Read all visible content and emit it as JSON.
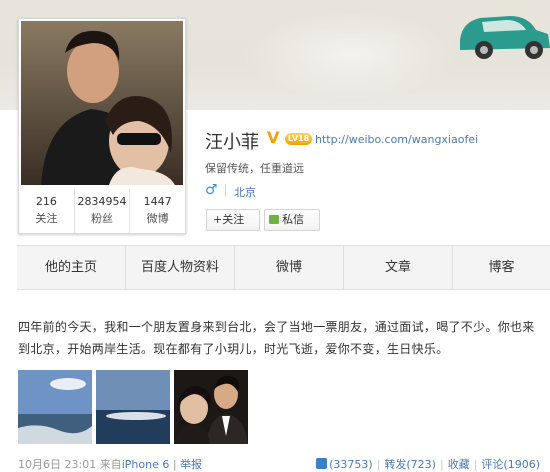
{
  "profile": {
    "name": "汪小菲",
    "level_badge": "LV18",
    "url": "http://weibo.com/wangxiaofei",
    "bio": "保留传统，任重道远",
    "gender_symbol": "♂",
    "location": "北京",
    "follow_label": "+关注",
    "message_label": "私信",
    "verified_symbol": "V"
  },
  "stats": [
    {
      "value": "216",
      "label": "关注"
    },
    {
      "value": "2834954",
      "label": "粉丝"
    },
    {
      "value": "1447",
      "label": "微博"
    }
  ],
  "tabs": [
    "他的主页",
    "百度人物资料",
    "微博",
    "文章",
    "博客"
  ],
  "post": {
    "text": "四年前的今天，我和一个朋友置身来到台北，会了当地一票朋友，通过面试，喝了不少。你也来到北京，开始两岸生活。现在都有了小玥儿，时光飞逝，爱你不变，生日快乐。",
    "time": "10月6日 23:01",
    "source_prefix": "来自",
    "source": "iPhone 6",
    "report": "举报",
    "likes": "(33753)",
    "repost": "转发(723)",
    "favorite": "收藏",
    "comment": "评论(1906)",
    "separator": "|"
  },
  "colors": {
    "link": "#4a7ab5",
    "accent_orange": "#f5a000",
    "msg_green": "#6db33f"
  }
}
